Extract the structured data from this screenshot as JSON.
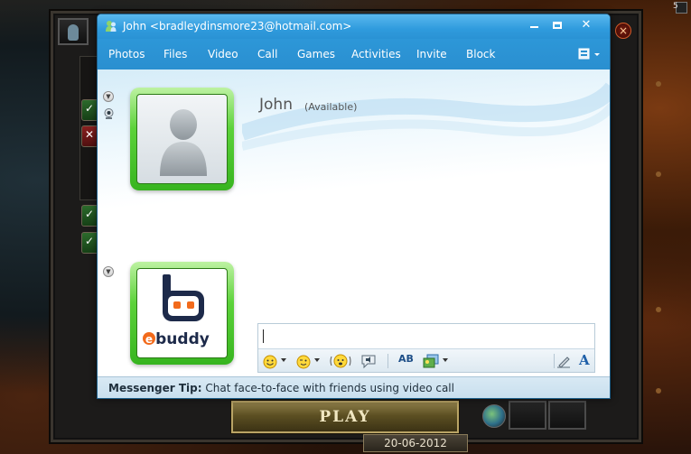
{
  "game": {
    "play_label": "Play",
    "date": "20-06-2012",
    "close_glyph": "×",
    "corner_number": "5"
  },
  "messenger": {
    "window_title": "John <bradleydinsmore23@hotmail.com>",
    "window_controls": {
      "minimize": "",
      "maximize": "",
      "close": "✕"
    },
    "menu": [
      "Photos",
      "Files",
      "Video",
      "Call",
      "Games",
      "Activities",
      "Invite",
      "Block"
    ],
    "contact": {
      "name": "John",
      "status": "(Available)"
    },
    "compose": {
      "value": "",
      "placeholder": ""
    },
    "toolbar_icons": [
      "emoticon-icon",
      "wink-icon",
      "nudge-icon",
      "voice-clip-icon",
      "spellcheck-icon",
      "backgrounds-icon",
      "handwriting-icon",
      "font-icon"
    ],
    "font_glyph": "A",
    "spellcheck_glyph": "AB",
    "tip": {
      "prefix": "Messenger Tip:",
      "text": " Chat face-to-face with friends using video call"
    },
    "my_picture_brand": "ebuddy",
    "accent_color": "#2f9bdd",
    "status_color": "#37b41f"
  }
}
